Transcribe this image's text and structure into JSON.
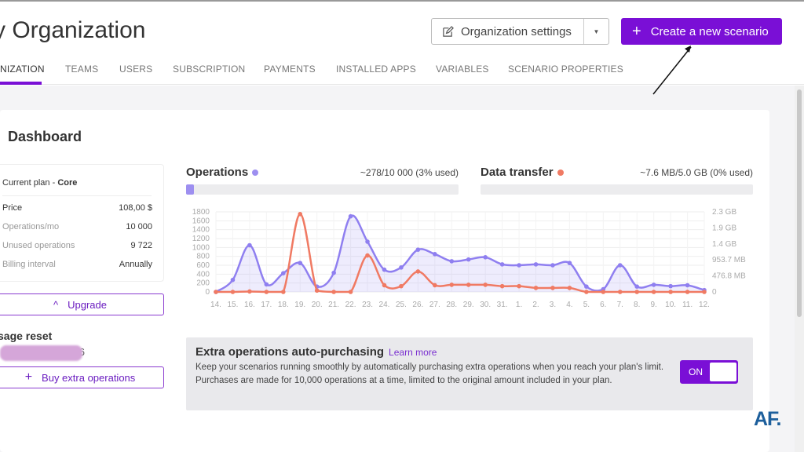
{
  "header": {
    "title": "y Organization",
    "settings_label": "Organization settings",
    "create_label": "Create a new scenario"
  },
  "tabs": [
    {
      "label": "NIZATION",
      "active": true
    },
    {
      "label": "TEAMS"
    },
    {
      "label": "USERS"
    },
    {
      "label": "SUBSCRIPTION"
    },
    {
      "label": "PAYMENTS"
    },
    {
      "label": "INSTALLED APPS"
    },
    {
      "label": "VARIABLES"
    },
    {
      "label": "SCENARIO PROPERTIES"
    }
  ],
  "dashboard": {
    "title": "Dashboard",
    "plan": {
      "label": "Current plan - ",
      "name": "Core",
      "rows": [
        {
          "label": "Price",
          "value": "108,00 $"
        },
        {
          "label": "Operations/mo",
          "value": "10 000"
        },
        {
          "label": "Unused operations",
          "value": "9 722"
        },
        {
          "label": "Billing interval",
          "value": "Annually"
        }
      ]
    },
    "upgrade_label": "Upgrade",
    "usage_reset_title": "sage reset",
    "usage_reset_value": "26",
    "buy_label": "Buy extra operations",
    "operations": {
      "title": "Operations",
      "usage": "~278/10 000 (3% used)",
      "percent": 3,
      "color": "#9d8ff0"
    },
    "data_transfer": {
      "title": "Data transfer",
      "usage": "~7.6 MB/5.0 GB (0% used)",
      "percent": 0,
      "color": "#f07a63"
    },
    "auto_purchase": {
      "title": "Extra operations auto-purchasing",
      "link": "Learn more",
      "description": "Keep your scenarios running smoothly by automatically purchasing extra operations when you reach your plan's limit. Purchases are made for 10,000 operations at a time, limited to the original amount included in your plan.",
      "toggle": "ON",
      "enabled": true
    }
  },
  "chart_data": {
    "type": "line",
    "x": [
      "14.",
      "15.",
      "16.",
      "17.",
      "18.",
      "19.",
      "20.",
      "21.",
      "22.",
      "23.",
      "24.",
      "25.",
      "26.",
      "27.",
      "28.",
      "29.",
      "30.",
      "31.",
      "1.",
      "2.",
      "3.",
      "4.",
      "5.",
      "6.",
      "7.",
      "8.",
      "9.",
      "10.",
      "11.",
      "12."
    ],
    "left_ticks": [
      "0",
      "200",
      "400",
      "600",
      "800",
      "1000",
      "1200",
      "1400",
      "1600",
      "1800"
    ],
    "right_ticks": [
      "0",
      "476.8 MB",
      "953.7 MB",
      "1.4 GB",
      "1.9 GB",
      "2.3 GB"
    ],
    "ylim": [
      0,
      1800
    ],
    "y2lim_mb": [
      0,
      2384
    ],
    "grid": true,
    "series": [
      {
        "name": "Operations",
        "axis": "left",
        "color": "#8f7ff0",
        "fill": true,
        "values": [
          0,
          270,
          1050,
          170,
          420,
          650,
          120,
          430,
          1700,
          1130,
          500,
          550,
          950,
          850,
          690,
          730,
          780,
          620,
          600,
          620,
          600,
          650,
          120,
          60,
          600,
          120,
          160,
          130,
          150,
          40
        ]
      },
      {
        "name": "Data transfer",
        "axis": "right",
        "unit": "MB",
        "color": "#f07a63",
        "values": [
          0,
          0,
          13,
          0,
          0,
          2318,
          40,
          0,
          0,
          1086,
          199,
          172,
          609,
          199,
          212,
          212,
          212,
          172,
          172,
          119,
          119,
          119,
          0,
          0,
          0,
          0,
          0,
          0,
          0,
          0
        ]
      }
    ]
  },
  "watermark": "AF."
}
